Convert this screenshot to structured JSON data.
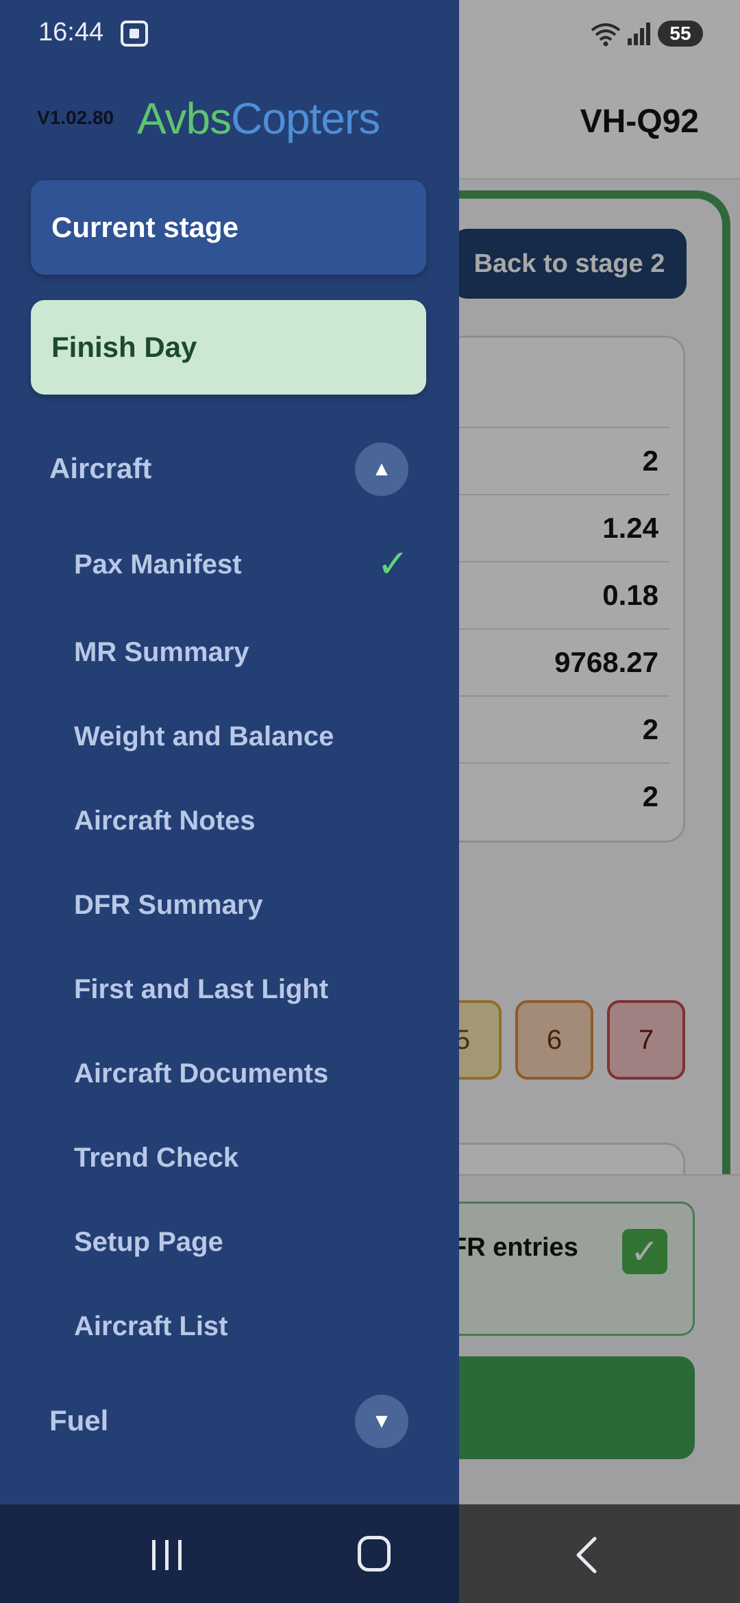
{
  "status_bar": {
    "time": "16:44",
    "battery": "55",
    "wifi_icon": "wifi-icon",
    "signal_icon": "signal-icon",
    "screen_icon": "screenshot-icon"
  },
  "background": {
    "tail_number": "VH-Q92",
    "back_button_label": "Back to stage 2",
    "summary_values": [
      "2",
      "1.24",
      "0.18",
      "9768.27",
      "2",
      "2"
    ],
    "ratings": [
      "5",
      "6",
      "7"
    ],
    "dfr_text": "FR entries",
    "dfr_check": "✓"
  },
  "drawer": {
    "version": "V1.02.80",
    "logo_part_a": "Avbs",
    "logo_part_b": "Copters",
    "current_stage_label": "Current stage",
    "finish_day_label": "Finish Day",
    "sections": {
      "aircraft": {
        "label": "Aircraft",
        "toggle": "▲",
        "items": [
          {
            "label": "Pax Manifest",
            "check": "✓"
          },
          {
            "label": "MR Summary"
          },
          {
            "label": "Weight and Balance"
          },
          {
            "label": "Aircraft Notes"
          },
          {
            "label": "DFR Summary"
          },
          {
            "label": "First and Last Light"
          },
          {
            "label": "Aircraft Documents"
          },
          {
            "label": "Trend Check"
          },
          {
            "label": "Setup Page"
          },
          {
            "label": "Aircraft List"
          }
        ]
      },
      "fuel": {
        "label": "Fuel",
        "toggle": "▼"
      }
    }
  },
  "colors": {
    "drawer_bg": "#243f74",
    "current_stage_bg": "#2f5395",
    "finish_day_bg": "#cce8d2",
    "check_green": "#5fd37b"
  }
}
